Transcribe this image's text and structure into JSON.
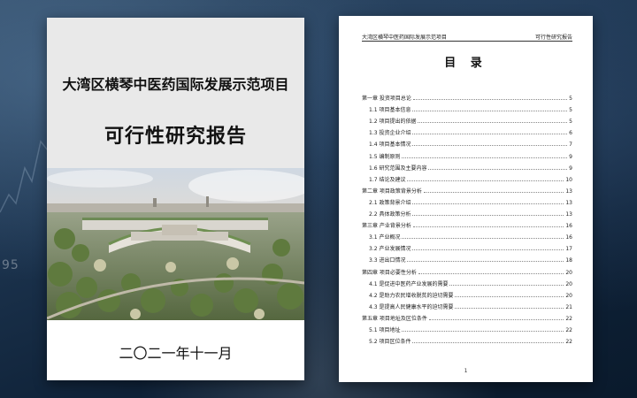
{
  "background": {
    "number_text": "95"
  },
  "cover": {
    "title": "大湾区横琴中医药国际发展示范项目",
    "subtitle": "可行性研究报告",
    "date": "二〇二一年十一月"
  },
  "toc": {
    "header_left": "大湾区横琴中医药国际发展示范项目",
    "header_right": "可行性研究报告",
    "title": "目 录",
    "page_number": "1",
    "entries": [
      {
        "label": "第一章  投资项目总论",
        "page": "5",
        "level": 1
      },
      {
        "label": "1.1 项目基本信息",
        "page": "5",
        "level": 2
      },
      {
        "label": "1.2 项目提出的依据",
        "page": "5",
        "level": 2
      },
      {
        "label": "1.3 投资企业介绍",
        "page": "6",
        "level": 2
      },
      {
        "label": "1.4 项目基本情况",
        "page": "7",
        "level": 2
      },
      {
        "label": "1.5 编制原则",
        "page": "9",
        "level": 2
      },
      {
        "label": "1.6 研究范围及主要内容",
        "page": "9",
        "level": 2
      },
      {
        "label": "1.7 结论及建议",
        "page": "10",
        "level": 2
      },
      {
        "label": "第二章  项目政策背景分析",
        "page": "13",
        "level": 1
      },
      {
        "label": "2.1 政策背景介绍",
        "page": "13",
        "level": 2
      },
      {
        "label": "2.2 具体政策分析",
        "page": "13",
        "level": 2
      },
      {
        "label": "第三章  产业背景分析",
        "page": "16",
        "level": 1
      },
      {
        "label": "3.1 产业概况",
        "page": "16",
        "level": 2
      },
      {
        "label": "3.2 产业发展情况",
        "page": "17",
        "level": 2
      },
      {
        "label": "3.3 进出口情况",
        "page": "18",
        "level": 2
      },
      {
        "label": "第四章  项目必要性分析",
        "page": "20",
        "level": 1
      },
      {
        "label": "4.1 是促进中医药产业发展的需要",
        "page": "20",
        "level": 2
      },
      {
        "label": "4.2 是助力农民增收脱贫的迫切需要",
        "page": "20",
        "level": 2
      },
      {
        "label": "4.3 是提高人民健康水平的迫切需要",
        "page": "21",
        "level": 2
      },
      {
        "label": "第五章  项目地址及区位条件",
        "page": "22",
        "level": 1
      },
      {
        "label": "5.1 项目地址",
        "page": "22",
        "level": 2
      },
      {
        "label": "5.2 项目区位条件",
        "page": "22",
        "level": 2
      }
    ]
  }
}
